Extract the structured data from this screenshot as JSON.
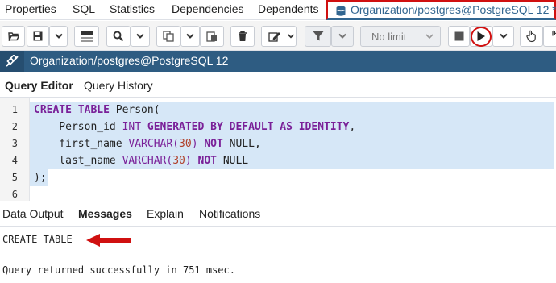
{
  "top_tabs": [
    "Properties",
    "SQL",
    "Statistics",
    "Dependencies",
    "Dependents"
  ],
  "query_tab": {
    "label": "Organization/postgres@PostgreSQL 12 *"
  },
  "toolbar": {
    "limit_value": "No limit"
  },
  "connection": {
    "label": "Organization/postgres@PostgreSQL 12"
  },
  "editor_tabs": [
    "Query Editor",
    "Query History"
  ],
  "editor": {
    "line_numbers": [
      "1",
      "2",
      "3",
      "4",
      "5",
      "6"
    ],
    "lines": [
      [
        {
          "t": "kw",
          "v": "CREATE TABLE "
        },
        {
          "t": "pl",
          "v": "Person("
        }
      ],
      [
        {
          "t": "pl",
          "v": "    Person_id "
        },
        {
          "t": "ty",
          "v": "INT "
        },
        {
          "t": "kw",
          "v": "GENERATED BY DEFAULT AS IDENTITY"
        },
        {
          "t": "pl",
          "v": ","
        }
      ],
      [
        {
          "t": "pl",
          "v": "    first_name "
        },
        {
          "t": "ty",
          "v": "VARCHAR("
        },
        {
          "t": "nm",
          "v": "30"
        },
        {
          "t": "ty",
          "v": ") "
        },
        {
          "t": "kw",
          "v": "NOT "
        },
        {
          "t": "pl",
          "v": "NULL,"
        }
      ],
      [
        {
          "t": "pl",
          "v": "    last_name "
        },
        {
          "t": "ty",
          "v": "VARCHAR("
        },
        {
          "t": "nm",
          "v": "30"
        },
        {
          "t": "ty",
          "v": ") "
        },
        {
          "t": "kw",
          "v": "NOT "
        },
        {
          "t": "pl",
          "v": "NULL"
        }
      ],
      [
        {
          "t": "pl",
          "v": ");"
        }
      ],
      []
    ]
  },
  "result_tabs": [
    "Data Output",
    "Messages",
    "Explain",
    "Notifications"
  ],
  "messages": {
    "line1": "CREATE TABLE",
    "line2": "Query returned successfully in 751 msec."
  },
  "colors": {
    "accent": "#326690",
    "connection_bar": "#2e5c82",
    "annotation": "#d01010",
    "selection": "#d6e7f7"
  }
}
